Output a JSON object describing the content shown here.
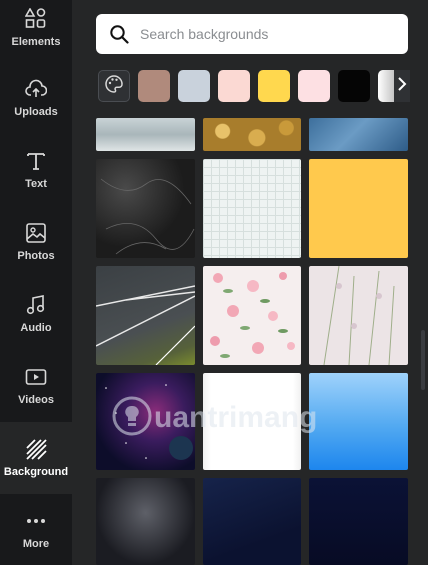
{
  "rail": {
    "items": [
      {
        "label": "Elements",
        "icon": "elements-icon"
      },
      {
        "label": "Uploads",
        "icon": "uploads-icon"
      },
      {
        "label": "Text",
        "icon": "text-icon"
      },
      {
        "label": "Photos",
        "icon": "photos-icon"
      },
      {
        "label": "Audio",
        "icon": "audio-icon"
      },
      {
        "label": "Videos",
        "icon": "videos-icon"
      },
      {
        "label": "Background",
        "icon": "background-icon",
        "active": true
      },
      {
        "label": "More",
        "icon": "more-icon"
      }
    ]
  },
  "search": {
    "placeholder": "Search backgrounds",
    "value": ""
  },
  "swatches": {
    "colors": [
      "#b08a7c",
      "#c9d2dc",
      "#fbd9d3",
      "#ffd84e",
      "#fde0e3",
      "#050505"
    ],
    "has_gradient": true
  },
  "watermark": "uantrimang",
  "colors": {
    "rail_bg": "#18191b",
    "panel_bg": "#252627",
    "accent_yellow": "#ffc94d"
  }
}
